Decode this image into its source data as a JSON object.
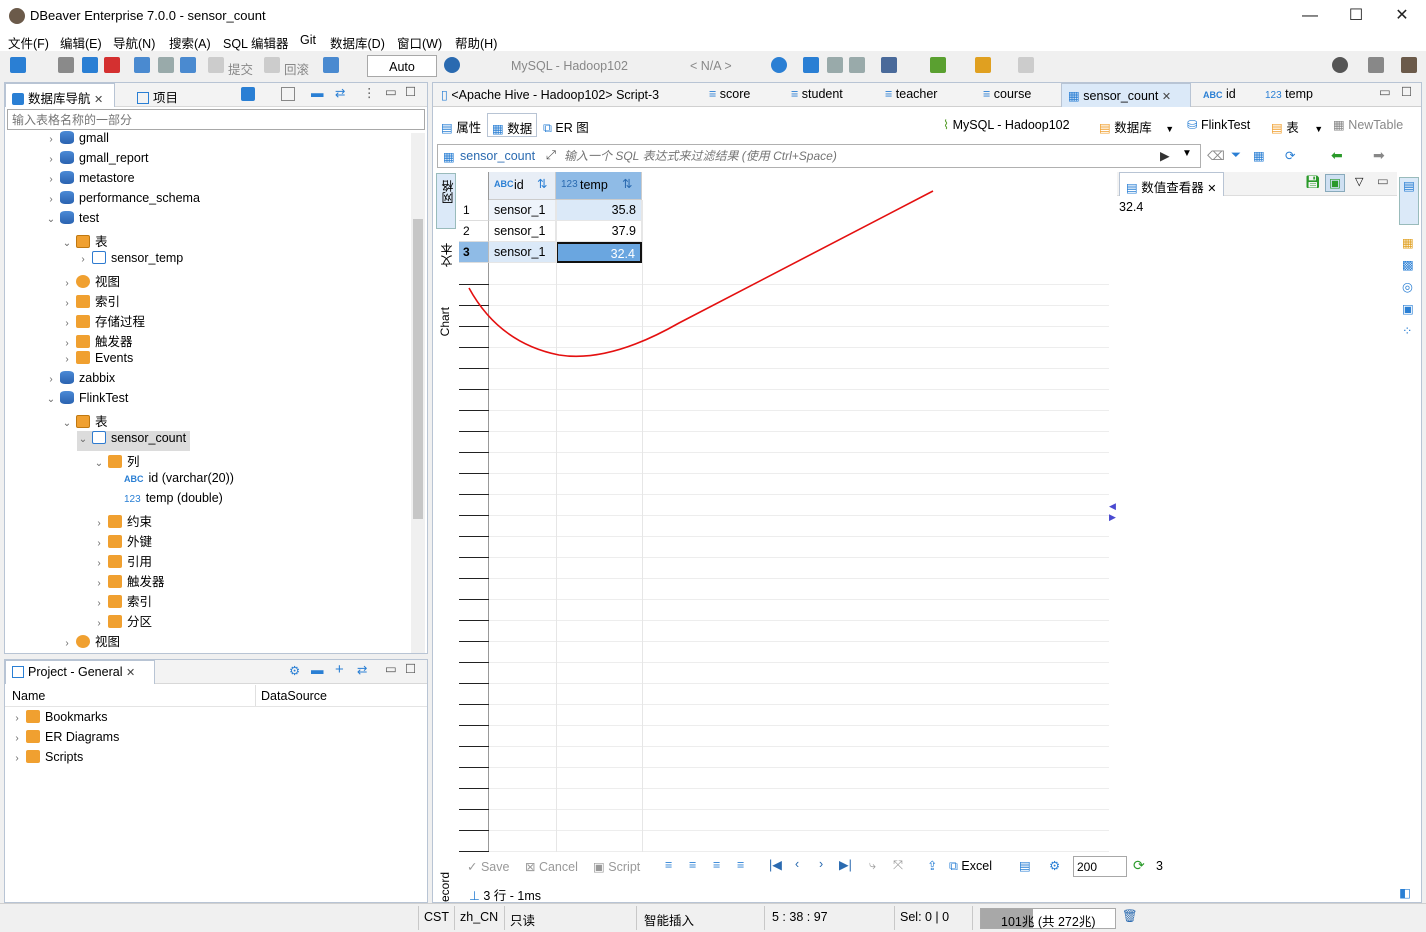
{
  "window": {
    "title": "DBeaver Enterprise 7.0.0 - sensor_count",
    "controls": [
      "—",
      "☐",
      "✕"
    ]
  },
  "menu": [
    "文件(F)",
    "编辑(E)",
    "导航(N)",
    "搜索(A)",
    "SQL 编辑器",
    "Git",
    "数据库(D)",
    "窗口(W)",
    "帮助(H)"
  ],
  "toolbar": {
    "commit_label": "提交",
    "rollback_label": "回滚",
    "tx_mode": "Auto",
    "datasource": "MySQL - Hadoop102",
    "schema": "< N/A >"
  },
  "navigator": {
    "tab_label": "数据库导航",
    "projects_tab_label": "项目",
    "filter_placeholder": "输入表格名称的一部分",
    "tree": [
      {
        "label": "gmall",
        "indent": 0,
        "icon": "db",
        "chev": "›"
      },
      {
        "label": "gmall_report",
        "indent": 0,
        "icon": "db",
        "chev": "›"
      },
      {
        "label": "metastore",
        "indent": 0,
        "icon": "db",
        "chev": "›"
      },
      {
        "label": "performance_schema",
        "indent": 0,
        "icon": "db",
        "chev": "›"
      },
      {
        "label": "test",
        "indent": 0,
        "icon": "db",
        "chev": "⌄"
      },
      {
        "label": "表",
        "indent": 1,
        "icon": "tablef",
        "chev": "⌄"
      },
      {
        "label": "sensor_temp",
        "indent": 2,
        "icon": "table",
        "chev": "›"
      },
      {
        "label": "视图",
        "indent": 1,
        "icon": "view",
        "chev": "›"
      },
      {
        "label": "索引",
        "indent": 1,
        "icon": "folder",
        "chev": "›"
      },
      {
        "label": "存储过程",
        "indent": 1,
        "icon": "folder",
        "chev": "›"
      },
      {
        "label": "触发器",
        "indent": 1,
        "icon": "folder",
        "chev": "›"
      },
      {
        "label": "Events",
        "indent": 1,
        "icon": "folder",
        "chev": "›"
      },
      {
        "label": "zabbix",
        "indent": 0,
        "icon": "db",
        "chev": "›"
      },
      {
        "label": "FlinkTest",
        "indent": 0,
        "icon": "db",
        "chev": "⌄"
      },
      {
        "label": "表",
        "indent": 1,
        "icon": "tablef",
        "chev": "⌄"
      },
      {
        "label": "sensor_count",
        "indent": 2,
        "icon": "table",
        "chev": "⌄",
        "selected": true
      },
      {
        "label": "列",
        "indent": 3,
        "icon": "cols",
        "chev": "⌄"
      },
      {
        "label": "id (varchar(20))",
        "indent": 4,
        "icon": "abc",
        "chev": ""
      },
      {
        "label": "temp (double)",
        "indent": 4,
        "icon": "num",
        "chev": ""
      },
      {
        "label": "约束",
        "indent": 3,
        "icon": "folder",
        "chev": "›"
      },
      {
        "label": "外键",
        "indent": 3,
        "icon": "folder",
        "chev": "›"
      },
      {
        "label": "引用",
        "indent": 3,
        "icon": "folder",
        "chev": "›"
      },
      {
        "label": "触发器",
        "indent": 3,
        "icon": "folder",
        "chev": "›"
      },
      {
        "label": "索引",
        "indent": 3,
        "icon": "folder",
        "chev": "›"
      },
      {
        "label": "分区",
        "indent": 3,
        "icon": "folder",
        "chev": "›"
      },
      {
        "label": "视图",
        "indent": 1,
        "icon": "view",
        "chev": "›"
      }
    ]
  },
  "project": {
    "tab_label": "Project - General",
    "col_name": "Name",
    "col_datasource": "DataSource",
    "items": [
      "Bookmarks",
      "ER Diagrams",
      "Scripts"
    ]
  },
  "editor_tabs": [
    {
      "label": "<Apache Hive - Hadoop102> Script-3"
    },
    {
      "label": "score"
    },
    {
      "label": "student"
    },
    {
      "label": "teacher"
    },
    {
      "label": "course"
    },
    {
      "label": "sensor_count",
      "active": true
    },
    {
      "label": "id"
    },
    {
      "label": "temp"
    }
  ],
  "subtabs": {
    "props": "属性",
    "data": "数据",
    "er": "ER 图",
    "ds": "MySQL - Hadoop102",
    "db": "数据库",
    "flink": "FlinkTest",
    "table": "表",
    "newtable": "NewTable"
  },
  "filter": {
    "table_name": "sensor_count",
    "placeholder": "输入一个 SQL 表达式来过滤结果 (使用 Ctrl+Space)"
  },
  "side_labels": [
    "网格",
    "文本",
    "Chart",
    "Record"
  ],
  "grid": {
    "columns": [
      {
        "type": "ABC",
        "name": "id"
      },
      {
        "type": "123",
        "name": "temp"
      }
    ],
    "rows": [
      {
        "num": "1",
        "id": "sensor_1",
        "temp": "35.8"
      },
      {
        "num": "2",
        "id": "sensor_1",
        "temp": "37.9"
      },
      {
        "num": "3",
        "id": "sensor_1",
        "temp": "32.4"
      }
    ]
  },
  "value_viewer": {
    "title": "数值查看器",
    "value": "32.4"
  },
  "result_toolbar": {
    "save": "Save",
    "cancel": "Cancel",
    "script": "Script",
    "excel": "Excel",
    "fetch_size": "200",
    "count": "3",
    "summary": "3 行 - 1ms"
  },
  "status": {
    "tz": "CST",
    "locale": "zh_CN",
    "mode": "只读",
    "insert": "智能插入",
    "pos": "5 : 38 : 97",
    "sel": "Sel: 0 | 0",
    "memory": "101兆 (共 272兆)"
  }
}
